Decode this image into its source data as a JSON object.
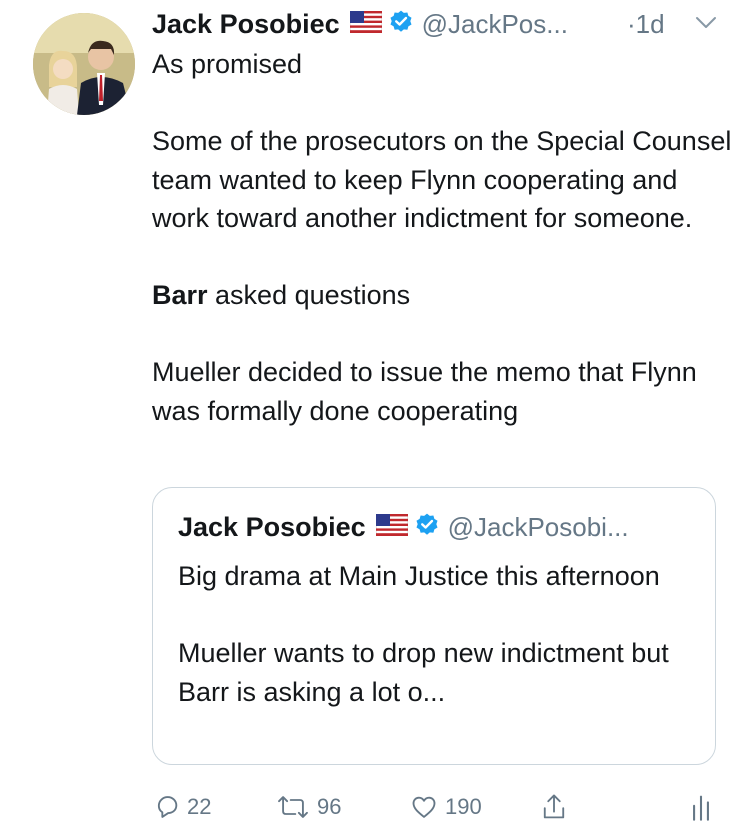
{
  "tweet": {
    "author_name": "Jack Posobiec",
    "flag_icon": "us-flag-icon",
    "verified_icon": "verified-badge-icon",
    "handle": "@JackPos...",
    "time": "·1d",
    "text_line1": "As promised",
    "text_para2": "Some of the prosecutors on the Special Counsel team wanted to keep Flynn cooperating and work toward another indictment for someone.",
    "text_para3_bold": "Barr",
    "text_para3_rest": " asked questions",
    "text_para4": "Mueller decided to issue the memo that Flynn was formally done cooperating"
  },
  "quoted_tweet": {
    "author_name": "Jack Posobiec",
    "handle": "@JackPosobi...",
    "text_para1": "Big drama at Main Justice this afternoon",
    "text_para2": "Mueller wants to drop new indictment but Barr is asking a lot o..."
  },
  "actions": {
    "replies": "22",
    "retweets": "96",
    "likes": "190"
  },
  "colors": {
    "text": "#14171a",
    "secondary": "#657786",
    "verified": "#1da1f2",
    "border": "#ccd6dd"
  }
}
